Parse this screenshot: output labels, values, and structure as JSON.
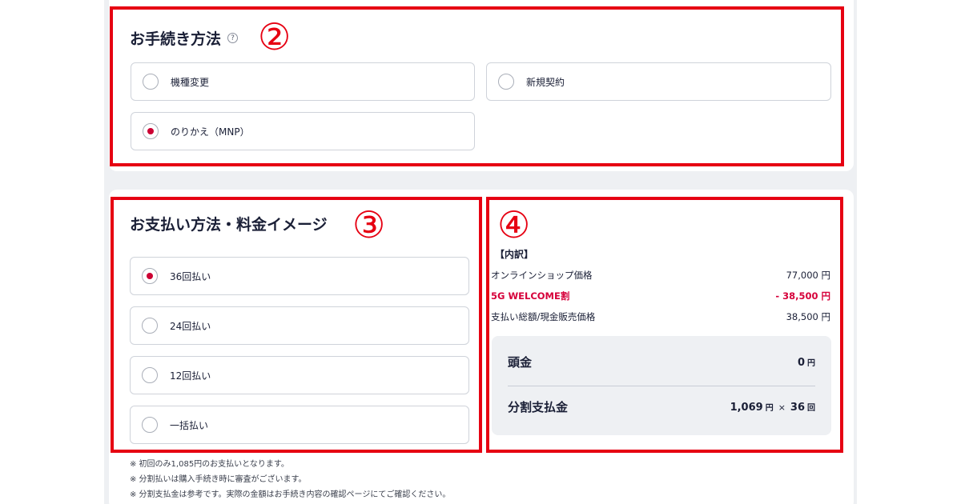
{
  "procedure": {
    "title": "お手続き方法",
    "help_icon": "?",
    "marker": "②",
    "options": [
      {
        "label": "機種変更",
        "selected": false
      },
      {
        "label": "新規契約",
        "selected": false
      },
      {
        "label": "のりかえ（MNP）",
        "selected": true
      }
    ]
  },
  "payment": {
    "title": "お支払い方法・料金イメージ",
    "marker": "③",
    "options": [
      {
        "label": "36回払い",
        "selected": true
      },
      {
        "label": "24回払い",
        "selected": false
      },
      {
        "label": "12回払い",
        "selected": false
      },
      {
        "label": "一括払い",
        "selected": false
      }
    ]
  },
  "breakdown": {
    "marker": "④",
    "title": "【内訳】",
    "rows": [
      {
        "label": "オンラインショップ価格",
        "value": "77,000 円"
      },
      {
        "label": "5G WELCOME割",
        "value": "- 38,500 円"
      },
      {
        "label": "支払い総額/現金販売価格",
        "value": "38,500 円"
      }
    ],
    "down_payment": {
      "label": "頭金",
      "value": "0",
      "unit": "円"
    },
    "installment": {
      "label": "分割支払金",
      "value": "1,069",
      "unit": "円",
      "times": "×",
      "count": "36",
      "count_unit": "回"
    }
  },
  "notes": [
    "※ 初回のみ1,085円のお支払いとなります。",
    "※ 分割払いは購入手続き時に審査がございます。",
    "※ 分割支払金は参考です。実際の金額はお手続き内容の確認ページにてご確認ください。"
  ],
  "colors": {
    "highlight": "#e60012",
    "radio_checked": "#cc0033",
    "discount": "#d6003a"
  }
}
